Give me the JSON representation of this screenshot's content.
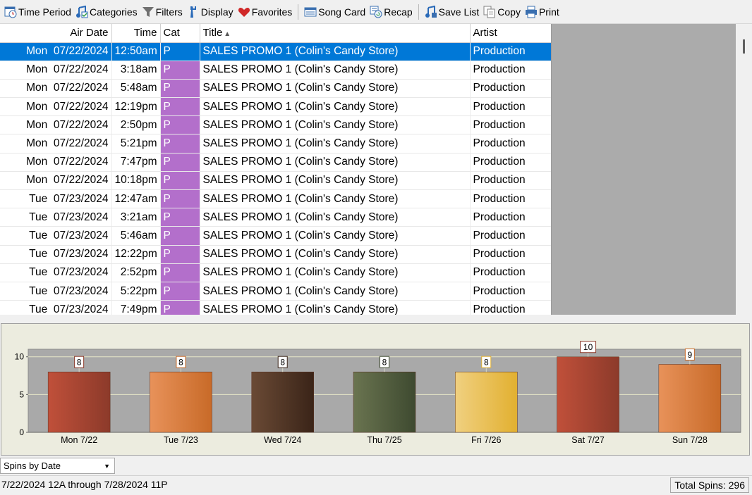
{
  "toolbar": {
    "time_period": "Time Period",
    "categories": "Categories",
    "filters": "Filters",
    "display": "Display",
    "favorites": "Favorites",
    "song_card": "Song Card",
    "recap": "Recap",
    "save_list": "Save List",
    "copy": "Copy",
    "print": "Print"
  },
  "grid": {
    "columns": {
      "air_date": "Air Date",
      "time": "Time",
      "cat": "Cat",
      "title": "Title",
      "artist": "Artist"
    },
    "rows": [
      {
        "day": "Mon",
        "date": "07/22/2024",
        "time": "12:50am",
        "cat": "P",
        "title": "SALES PROMO 1 (Colin's Candy Store)",
        "artist": "Production",
        "selected": true
      },
      {
        "day": "Mon",
        "date": "07/22/2024",
        "time": "3:18am",
        "cat": "P",
        "title": "SALES PROMO 1 (Colin's Candy Store)",
        "artist": "Production"
      },
      {
        "day": "Mon",
        "date": "07/22/2024",
        "time": "5:48am",
        "cat": "P",
        "title": "SALES PROMO 1 (Colin's Candy Store)",
        "artist": "Production"
      },
      {
        "day": "Mon",
        "date": "07/22/2024",
        "time": "12:19pm",
        "cat": "P",
        "title": "SALES PROMO 1 (Colin's Candy Store)",
        "artist": "Production"
      },
      {
        "day": "Mon",
        "date": "07/22/2024",
        "time": "2:50pm",
        "cat": "P",
        "title": "SALES PROMO 1 (Colin's Candy Store)",
        "artist": "Production"
      },
      {
        "day": "Mon",
        "date": "07/22/2024",
        "time": "5:21pm",
        "cat": "P",
        "title": "SALES PROMO 1 (Colin's Candy Store)",
        "artist": "Production"
      },
      {
        "day": "Mon",
        "date": "07/22/2024",
        "time": "7:47pm",
        "cat": "P",
        "title": "SALES PROMO 1 (Colin's Candy Store)",
        "artist": "Production"
      },
      {
        "day": "Mon",
        "date": "07/22/2024",
        "time": "10:18pm",
        "cat": "P",
        "title": "SALES PROMO 1 (Colin's Candy Store)",
        "artist": "Production"
      },
      {
        "day": "Tue",
        "date": "07/23/2024",
        "time": "12:47am",
        "cat": "P",
        "title": "SALES PROMO 1 (Colin's Candy Store)",
        "artist": "Production"
      },
      {
        "day": "Tue",
        "date": "07/23/2024",
        "time": "3:21am",
        "cat": "P",
        "title": "SALES PROMO 1 (Colin's Candy Store)",
        "artist": "Production"
      },
      {
        "day": "Tue",
        "date": "07/23/2024",
        "time": "5:46am",
        "cat": "P",
        "title": "SALES PROMO 1 (Colin's Candy Store)",
        "artist": "Production"
      },
      {
        "day": "Tue",
        "date": "07/23/2024",
        "time": "12:22pm",
        "cat": "P",
        "title": "SALES PROMO 1 (Colin's Candy Store)",
        "artist": "Production"
      },
      {
        "day": "Tue",
        "date": "07/23/2024",
        "time": "2:52pm",
        "cat": "P",
        "title": "SALES PROMO 1 (Colin's Candy Store)",
        "artist": "Production"
      },
      {
        "day": "Tue",
        "date": "07/23/2024",
        "time": "5:22pm",
        "cat": "P",
        "title": "SALES PROMO 1 (Colin's Candy Store)",
        "artist": "Production"
      },
      {
        "day": "Tue",
        "date": "07/23/2024",
        "time": "7:49pm",
        "cat": "P",
        "title": "SALES PROMO 1 (Colin's Candy Store)",
        "artist": "Production"
      }
    ],
    "category_color": "#b36fcb",
    "selection_color": "#0078d7"
  },
  "chart_data": {
    "type": "bar",
    "categories": [
      "Mon 7/22",
      "Tue 7/23",
      "Wed 7/24",
      "Thu 7/25",
      "Fri 7/26",
      "Sat 7/27",
      "Sun 7/28"
    ],
    "values": [
      8,
      8,
      8,
      8,
      8,
      10,
      9
    ],
    "colors": [
      [
        "#c0503a",
        "#8c3a2a"
      ],
      [
        "#e8925a",
        "#c86a28"
      ],
      [
        "#6a4a35",
        "#3a2418"
      ],
      [
        "#6a7450",
        "#3e4a30"
      ],
      [
        "#f0d080",
        "#e2b030"
      ],
      [
        "#c0503a",
        "#8c3a2a"
      ],
      [
        "#e8925a",
        "#c86a28"
      ]
    ],
    "y_ticks": [
      0,
      5,
      10
    ],
    "ylim": [
      0,
      11
    ],
    "grid": true,
    "title": "",
    "xlabel": "",
    "ylabel": ""
  },
  "bottom": {
    "chart_select": "Spins by Date",
    "date_range": "7/22/2024 12A through 7/28/2024 11P",
    "total_spins": "Total Spins: 296"
  }
}
